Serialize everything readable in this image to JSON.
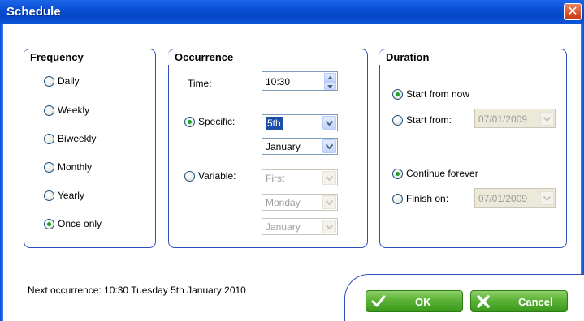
{
  "window": {
    "title": "Schedule",
    "close_glyph": "✕"
  },
  "frequency": {
    "legend": "Frequency",
    "options": [
      {
        "label": "Daily",
        "checked": false
      },
      {
        "label": "Weekly",
        "checked": false
      },
      {
        "label": "Biweekly",
        "checked": false
      },
      {
        "label": "Monthly",
        "checked": false
      },
      {
        "label": "Yearly",
        "checked": false
      },
      {
        "label": "Once only",
        "checked": true
      }
    ]
  },
  "occurrence": {
    "legend": "Occurrence",
    "time_label": "Time:",
    "time_value": "10:30",
    "specific_label": "Specific:",
    "specific_checked": true,
    "specific_day": "5th",
    "specific_month": "January",
    "variable_label": "Variable:",
    "variable_checked": false,
    "variable_week": "First",
    "variable_weekday": "Monday",
    "variable_month": "January"
  },
  "duration": {
    "legend": "Duration",
    "start_now_label": "Start from now",
    "start_now_checked": true,
    "start_from_label": "Start from:",
    "start_from_checked": false,
    "start_from_date": "07/01/2009",
    "continue_label": "Continue forever",
    "continue_checked": true,
    "finish_label": "Finish on:",
    "finish_checked": false,
    "finish_date": "07/01/2009"
  },
  "footer": {
    "next_occurrence": "Next occurrence: 10:30 Tuesday 5th January 2010",
    "ok_label": "OK",
    "cancel_label": "Cancel"
  },
  "colors": {
    "titlebar": "#0a4fd6",
    "button_green": "#5cb337",
    "group_border": "#2f4fb8"
  }
}
